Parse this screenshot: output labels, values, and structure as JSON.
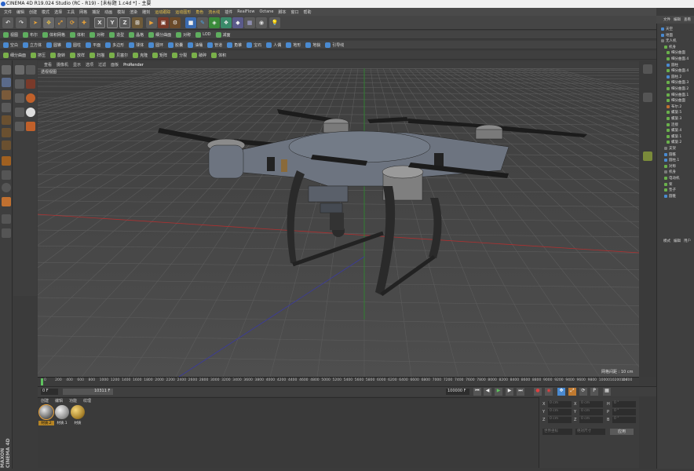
{
  "window": {
    "title": "CINEMA 4D R19.024 Studio (RC - R19) - [未标题 1.c4d *] - 主要"
  },
  "menubar": [
    "文件",
    "编辑",
    "创建",
    "模式",
    "选择",
    "工具",
    "网格",
    "捕捉",
    "动画",
    "模拟",
    "渲染",
    "雕刻",
    "运动跟踪",
    "运动图形",
    "角色",
    "流水线",
    "插件",
    "RealFlow",
    "Octane",
    "脚本",
    "窗口",
    "帮助"
  ],
  "menubar_highlight": [
    "运动跟踪",
    "运动图形",
    "角色",
    "流水线"
  ],
  "toolbar1": {
    "axis_labels": [
      "X",
      "Y",
      "Z"
    ]
  },
  "toolbar2": [
    "视图",
    "布尔",
    "体积网格",
    "体积",
    "对称",
    "造型",
    "晶格",
    "细分曲面",
    "对称",
    "LOD",
    "减面"
  ],
  "toolbar3": [
    "空白",
    "立方体",
    "圆锥",
    "圆柱",
    "平面",
    "多边形",
    "球体",
    "圆环",
    "胶囊",
    "油桶",
    "管道",
    "角锥",
    "宝石",
    "人偶",
    "地形",
    "地貌",
    "引导线"
  ],
  "toolbar4": [
    "细分曲面",
    "挤压",
    "旋转",
    "放样",
    "扫描",
    "贝塞尔",
    "克隆",
    "矩阵",
    "分裂",
    "破碎",
    "体积"
  ],
  "viewport": {
    "menu": [
      "查看",
      "摄像机",
      "显示",
      "选项",
      "过滤",
      "面板",
      "ProRender"
    ],
    "active_menu": "ProRender",
    "label": "透视视图",
    "grid_scale": "网格间距 : 10 cm"
  },
  "timeline": {
    "ticks": [
      "0",
      "200",
      "400",
      "600",
      "800",
      "1000",
      "1200",
      "1400",
      "1600",
      "1800",
      "2000",
      "2200",
      "2400",
      "2600",
      "2800",
      "3000",
      "3200",
      "3400",
      "3600",
      "3800",
      "4000",
      "4200",
      "4400",
      "4600",
      "4800",
      "5000",
      "5200",
      "5400",
      "5600",
      "5800",
      "6000",
      "6200",
      "6400",
      "6600",
      "6800",
      "7000",
      "7200",
      "7400",
      "7600",
      "7800",
      "8000",
      "8200",
      "8400",
      "8600",
      "8800",
      "9000",
      "9200",
      "9400",
      "9600",
      "9800",
      "10000",
      "10200",
      "10400"
    ],
    "end_label": "0 F"
  },
  "transport": {
    "start": "0 F",
    "current": "0 F",
    "end_time": "10311 F",
    "max": "100000 F"
  },
  "material_panel": {
    "menu": [
      "创建",
      "编辑",
      "功能",
      "纹理"
    ],
    "materials": [
      {
        "name": "材质.2",
        "color": "#8a8a8a",
        "selected": true
      },
      {
        "name": "材质.1",
        "color": "#9a9a9a",
        "selected": false
      },
      {
        "name": "材质",
        "color": "#a7812a",
        "selected": false
      }
    ]
  },
  "coordinates": {
    "rows": [
      {
        "axis": "X",
        "pos": "0 cm",
        "axis2": "X",
        "size": "0 cm",
        "axis3": "H",
        "rot": "0 °"
      },
      {
        "axis": "Y",
        "pos": "0 cm",
        "axis2": "Y",
        "size": "0 cm",
        "axis3": "P",
        "rot": "0 °"
      },
      {
        "axis": "Z",
        "pos": "0 cm",
        "axis2": "Z",
        "size": "0 cm",
        "axis3": "B",
        "rot": "0 °"
      }
    ],
    "mode": "世界坐标",
    "size_mode": "绝对尺寸",
    "apply": "应用"
  },
  "object_panel": {
    "menu": [
      "文件",
      "编辑",
      "查看"
    ],
    "items": [
      "天空",
      "地面",
      "无人机",
      "机身",
      "细分曲面",
      "细分曲面.4",
      "圆柱",
      "细分曲面.4",
      "圆柱.2",
      "细分曲面.3",
      "细分曲面.2",
      "细分曲面.1",
      "细分曲面",
      "布尔.2",
      "螺旋.5",
      "螺旋.3",
      "连接",
      "螺旋.4",
      "螺旋.1",
      "螺旋.2",
      "支架",
      "圆锥",
      "圆柱.1",
      "对称",
      "机身",
      "电动机",
      "桨",
      "垫子",
      "圆锥"
    ]
  },
  "attribute_panel": {
    "menu": [
      "模式",
      "编辑",
      "用户"
    ]
  },
  "brand": {
    "name": "MAXON CINEMA 4D"
  }
}
